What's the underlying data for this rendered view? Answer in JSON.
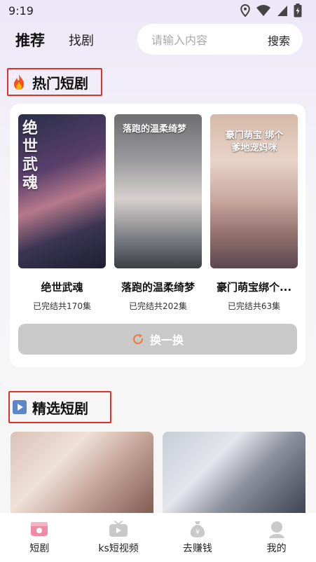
{
  "status_bar": {
    "time": "9:19"
  },
  "header": {
    "tabs": [
      {
        "label": "推荐",
        "active": true
      },
      {
        "label": "找剧",
        "active": false
      }
    ],
    "search": {
      "placeholder": "请输入内容",
      "button_label": "搜索"
    }
  },
  "hot_section": {
    "title": "热门短剧",
    "dramas": [
      {
        "title": "绝世武魂",
        "meta": "已完结共170集",
        "poster_text": "绝世武魂"
      },
      {
        "title": "落跑的温柔绮梦",
        "meta": "已完结共202集",
        "poster_text": "落跑的温柔绮梦"
      },
      {
        "title": "豪门萌宝绑个...",
        "meta": "已完结共63集",
        "poster_text": "豪门萌宝 绑个爹地宠妈咪"
      }
    ],
    "swap_label": "换一换"
  },
  "featured_section": {
    "title": "精选短剧"
  },
  "bottom_nav": {
    "items": [
      {
        "label": "短剧",
        "icon": "drama-icon",
        "active": true
      },
      {
        "label": "ks短视频",
        "icon": "tv-icon",
        "active": false
      },
      {
        "label": "去赚钱",
        "icon": "money-bag-icon",
        "active": false
      },
      {
        "label": "我的",
        "icon": "profile-icon",
        "active": false
      }
    ]
  },
  "colors": {
    "highlight_border": "#d9332b",
    "swap_button": "#c9c9c9",
    "swap_icon": "#f07a3a",
    "nav_active": "#f28aa6"
  }
}
